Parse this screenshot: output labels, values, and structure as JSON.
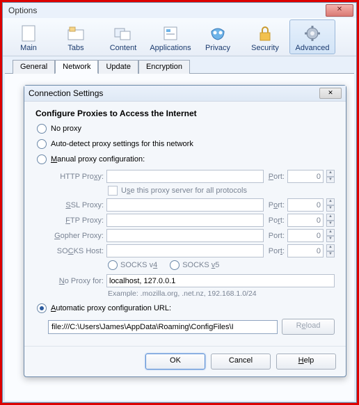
{
  "window_title": "Options",
  "toolbar": [
    {
      "label": "Main"
    },
    {
      "label": "Tabs"
    },
    {
      "label": "Content"
    },
    {
      "label": "Applications"
    },
    {
      "label": "Privacy"
    },
    {
      "label": "Security"
    },
    {
      "label": "Advanced"
    }
  ],
  "tabs": [
    "General",
    "Network",
    "Update",
    "Encryption"
  ],
  "dialog": {
    "title": "Connection Settings",
    "heading": "Configure Proxies to Access the Internet",
    "opt_no_proxy": "No proxy",
    "opt_auto_detect": "Auto-detect proxy settings for this network",
    "opt_manual": "Manual proxy configuration:",
    "labels": {
      "http": "HTTP Proxy:",
      "ssl": "SSL Proxy:",
      "ftp": "FTP Proxy:",
      "gopher": "Gopher Proxy:",
      "socks": "SOCKS Host:",
      "port": "Port:",
      "noproxy": "No Proxy for:"
    },
    "use_all": "Use this proxy server for all protocols",
    "port_zero": "0",
    "socks_v4": "SOCKS v4",
    "socks_v5": "SOCKS v5",
    "noproxy_value": "localhost, 127.0.0.1",
    "example": "Example: .mozilla.org, .net.nz, 192.168.1.0/24",
    "opt_pac": "Automatic proxy configuration URL:",
    "pac_url": "file:///C:\\Users\\James\\AppData\\Roaming\\ConfigFiles\\I",
    "reload": "Reload",
    "ok": "OK",
    "cancel": "Cancel",
    "help": "Help"
  }
}
